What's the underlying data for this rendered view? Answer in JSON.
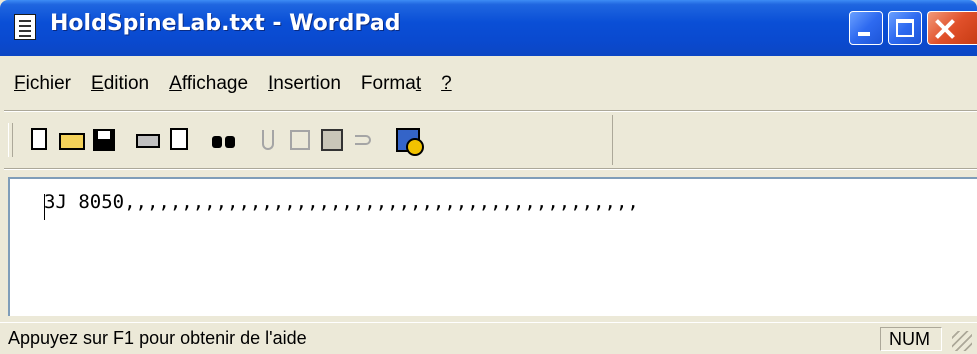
{
  "window": {
    "title": "HoldSpineLab.txt - WordPad"
  },
  "menu": [
    {
      "key": "F",
      "rest": "ichier"
    },
    {
      "key": "E",
      "rest": "dition"
    },
    {
      "key": "A",
      "rest": "ffichage"
    },
    {
      "key": "I",
      "rest": "nsertion"
    },
    {
      "pre": "Forma",
      "key": "t",
      "rest": ""
    },
    {
      "key": "?",
      "rest": ""
    }
  ],
  "document": {
    "text": "3J 8050,,,,,,,,,,,,,,,,,,,,,,,,,,,,,,,,,,,,,,,,,,,,,"
  },
  "status": {
    "help_text": "Appuyez sur F1 pour obtenir de l'aide",
    "num_indicator": "NUM"
  },
  "toolbar": {
    "icons": [
      "new-icon",
      "open-icon",
      "save-icon",
      "print-icon",
      "print-preview-icon",
      "find-icon",
      "cut-icon",
      "copy-icon",
      "paste-icon",
      "undo-icon",
      "date-time-icon"
    ]
  }
}
